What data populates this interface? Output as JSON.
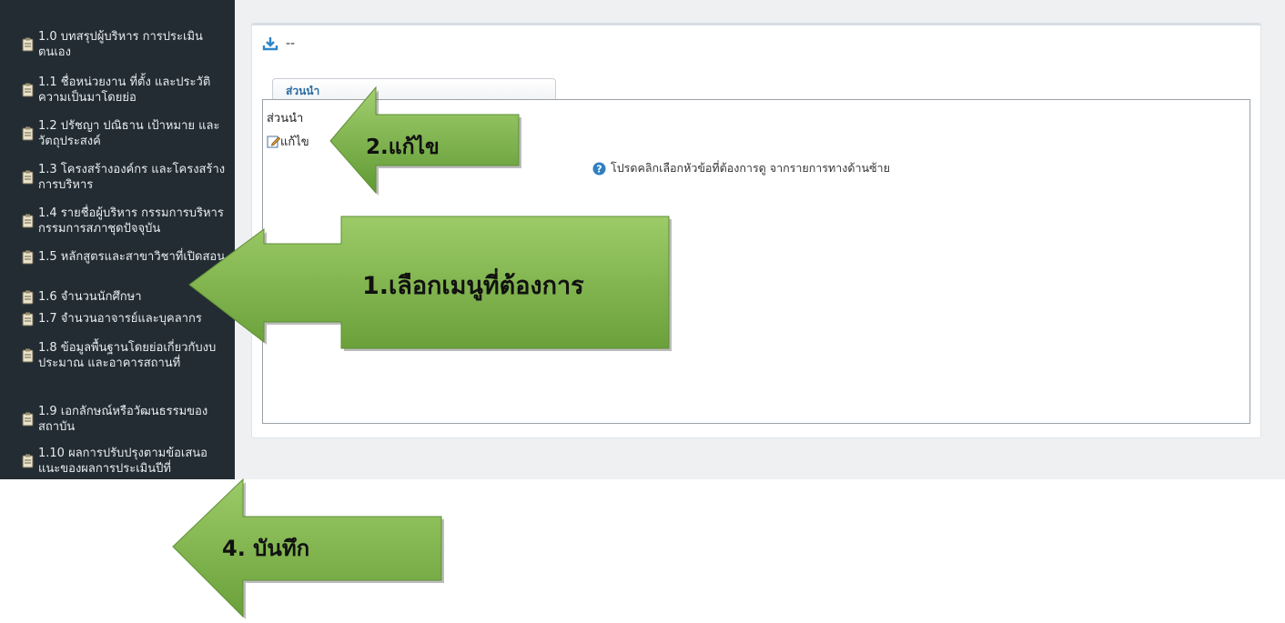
{
  "sidebar": {
    "items": [
      {
        "label": "1.0 บทสรุปผู้บริหาร การประเมินตนเอง"
      },
      {
        "label": "1.1 ชื่อหน่วยงาน ที่ตั้ง และประวัติความเป็นมาโดยย่อ"
      },
      {
        "label": "1.2 ปรัชญา ปณิธาน เป้าหมาย และวัตถุประสงค์"
      },
      {
        "label": "1.3 โครงสร้างองค์กร และโครงสร้างการบริหาร"
      },
      {
        "label": "1.4 รายชื่อผู้บริหาร กรรมการบริหาร กรรมการสภาชุดปัจจุบัน"
      },
      {
        "label": "1.5 หลักสูตรและสาขาวิชาที่เปิดสอน"
      },
      {
        "label": "1.6 จำนวนนักศึกษา"
      },
      {
        "label": "1.7 จำนวนอาจารย์และบุคลากร"
      },
      {
        "label": "1.8 ข้อมูลพื้นฐานโดยย่อเกี่ยวกับงบประมาณ และอาคารสถานที่"
      },
      {
        "label": "1.9 เอกลักษณ์หรือวัฒนธรรมของสถาบัน"
      },
      {
        "label": "1.10 ผลการปรับปรุงตามข้อเสนอแนะของผลการประเมินปีที่"
      }
    ]
  },
  "main": {
    "download_text": "--",
    "tab_label": "ส่วนนำ",
    "content_title": "ส่วนนำ",
    "edit_label": "แก้ไข",
    "hint_text": "โปรดคลิกเลือกหัวข้อที่ต้องการดู จากรายการทางด้านซ้าย"
  },
  "annotations": {
    "step1": "1.เลือกเมนูที่ต้องการ",
    "step2": "2.แก้ไข",
    "step4": "4. บันทึก"
  },
  "colors": {
    "sidebar_bg": "#232c33",
    "arrow_green": "#7fb24a",
    "link_blue": "#2a6ca3"
  }
}
